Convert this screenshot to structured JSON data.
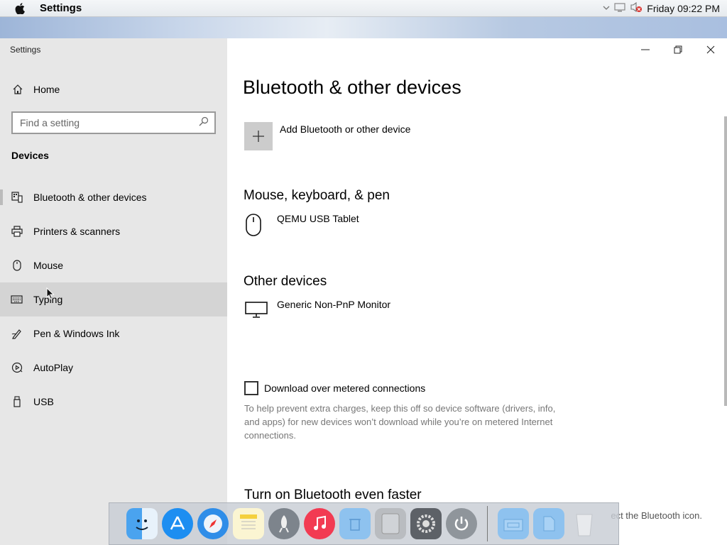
{
  "menubar": {
    "app_name": "Settings",
    "clock": "Friday 09:22 PM",
    "icons": [
      "apple-icon",
      "chevron-down-icon",
      "display-icon",
      "speaker-muted-icon"
    ]
  },
  "window": {
    "title": "Settings",
    "controls": [
      "minimize-icon",
      "restore-icon",
      "close-icon"
    ]
  },
  "sidebar": {
    "home_label": "Home",
    "search_placeholder": "Find a setting",
    "section_heading": "Devices",
    "items": [
      {
        "label": "Bluetooth & other devices",
        "icon": "bluetooth-devices-icon",
        "selected": true
      },
      {
        "label": "Printers & scanners",
        "icon": "printer-icon"
      },
      {
        "label": "Mouse",
        "icon": "mouse-icon"
      },
      {
        "label": "Typing",
        "icon": "keyboard-icon",
        "hovered": true
      },
      {
        "label": "Pen & Windows Ink",
        "icon": "pen-icon"
      },
      {
        "label": "AutoPlay",
        "icon": "autoplay-icon"
      },
      {
        "label": "USB",
        "icon": "usb-icon"
      }
    ]
  },
  "content": {
    "title": "Bluetooth & other devices",
    "add_device_label": "Add Bluetooth or other device",
    "mouse_section": {
      "heading": "Mouse, keyboard, & pen",
      "device": "QEMU USB Tablet"
    },
    "other_section": {
      "heading": "Other devices",
      "device": "Generic Non-PnP Monitor"
    },
    "metered_checkbox": {
      "label": "Download over metered connections",
      "checked": false
    },
    "metered_help": "To help prevent extra charges, keep this off so device software (drivers, info, and apps) for new devices won’t download while you’re on metered Internet connections.",
    "bluetooth_faster_heading": "Turn on Bluetooth even faster",
    "bluetooth_faster_text_end": "ect the Bluetooth icon."
  },
  "dock": {
    "apps": [
      "finder-icon",
      "app-store-icon",
      "safari-icon",
      "notes-icon",
      "launchpad-icon",
      "itunes-icon",
      "trash-folder-icon",
      "mac-pro-icon",
      "system-preferences-icon",
      "power-icon"
    ],
    "right": [
      "folder-icon",
      "documents-folder-icon",
      "trash-icon"
    ]
  }
}
